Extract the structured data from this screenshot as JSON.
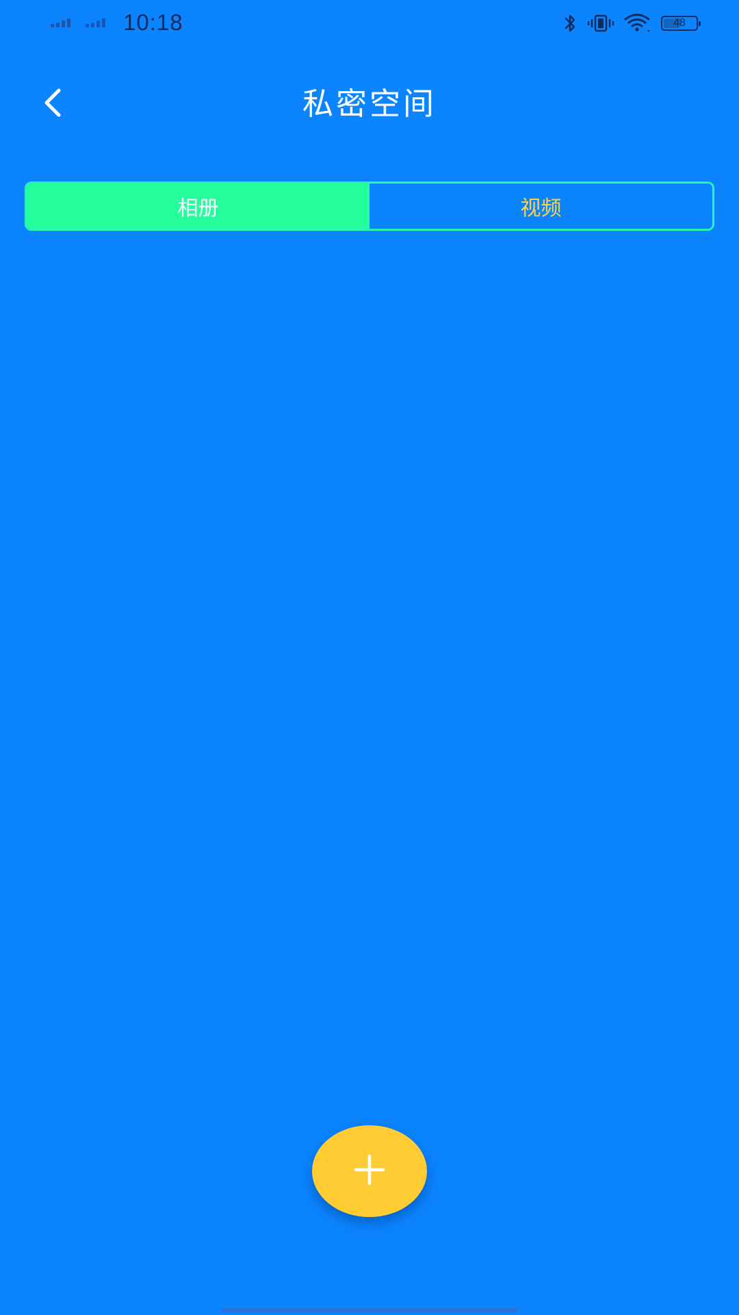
{
  "status_bar": {
    "time": "10:18",
    "battery_level": "48",
    "icons": [
      "signal-icon",
      "signal-icon",
      "bluetooth-icon",
      "vibrate-icon",
      "wifi-icon",
      "battery-icon"
    ]
  },
  "header": {
    "title": "私密空间",
    "back_icon": "chevron-left-icon"
  },
  "tabs": [
    {
      "label": "相册",
      "selected": true
    },
    {
      "label": "视频",
      "selected": false
    }
  ],
  "fab": {
    "icon": "plus-icon"
  },
  "colors": {
    "background": "#0b84fe",
    "tab_active": "#25fe9d",
    "tab_border": "#27f5b8",
    "tab_inactive_text": "#ffd33d",
    "fab": "#ffcc33"
  }
}
